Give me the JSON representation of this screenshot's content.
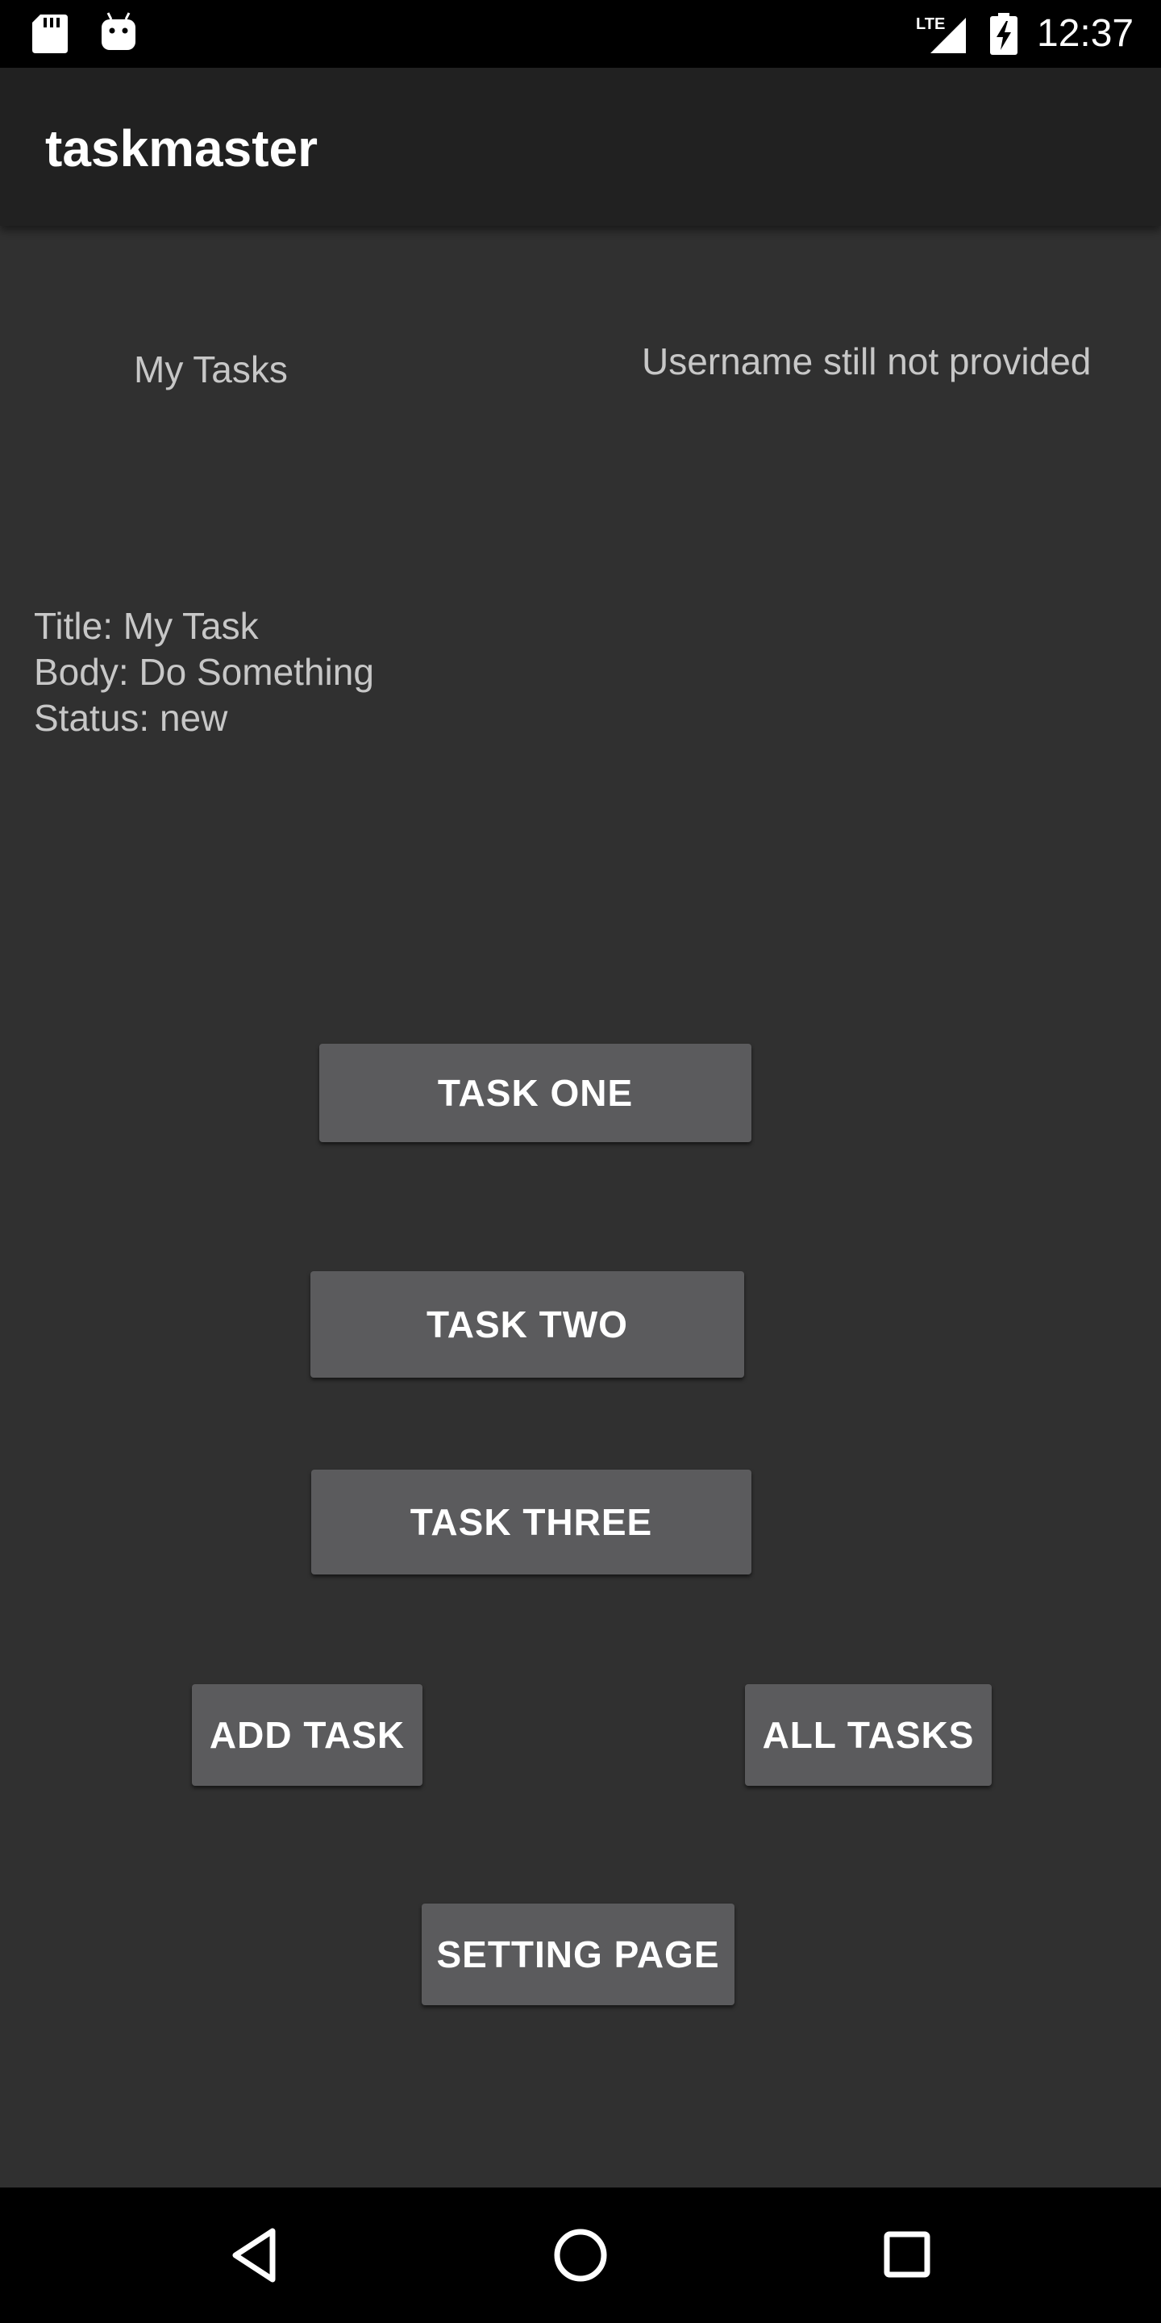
{
  "status_bar": {
    "time": "12:37",
    "network_label": "LTE",
    "icons": [
      "sd-card-icon",
      "android-icon",
      "signal-icon",
      "battery-charging-icon"
    ]
  },
  "app_bar": {
    "title": "taskmaster"
  },
  "main": {
    "heading": "My Tasks",
    "username": "Username still not provided",
    "task_detail": {
      "title": "Title: My Task",
      "body": "Body: Do Something",
      "status": "Status: new"
    },
    "buttons": {
      "task_one": "TASK ONE",
      "task_two": "TASK TWO",
      "task_three": "TASK THREE",
      "add_task": "ADD TASK",
      "all_tasks": "ALL TASKS",
      "setting_page": "SETTING PAGE"
    }
  },
  "nav_bar": {
    "icons": [
      "back-icon",
      "home-icon",
      "recent-apps-icon"
    ]
  },
  "colors": {
    "background": "#303030",
    "app_bar": "#212121",
    "button": "#5b5b5d",
    "text_secondary": "#c7c7c7"
  }
}
